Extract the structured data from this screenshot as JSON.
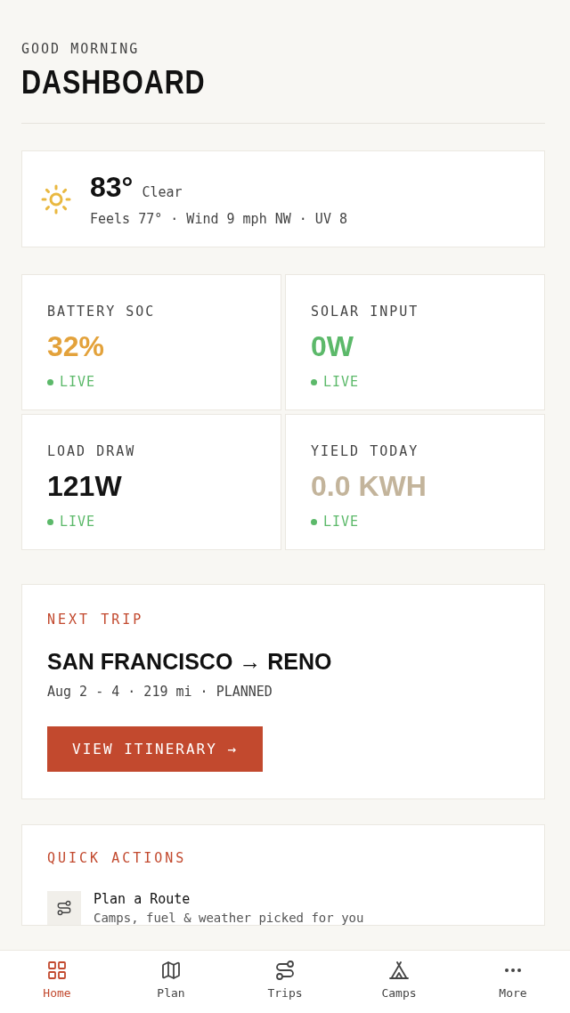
{
  "header": {
    "greeting": "GOOD MORNING",
    "title": "DASHBOARD"
  },
  "weather": {
    "temperature": "83°",
    "condition": "Clear",
    "details": "Feels 77° · Wind 9 mph NW · UV 8"
  },
  "metrics": [
    {
      "label": "BATTERY SOC",
      "value": "32%",
      "color": "#e3a23b",
      "status": "LIVE"
    },
    {
      "label": "SOLAR INPUT",
      "value": "0W",
      "color": "#5cb96a",
      "status": "LIVE"
    },
    {
      "label": "LOAD DRAW",
      "value": "121W",
      "color": "#141414",
      "status": "LIVE"
    },
    {
      "label": "YIELD TODAY",
      "value": "0.0 KWH",
      "color": "#c3b49b",
      "status": "LIVE"
    }
  ],
  "next_trip": {
    "heading": "NEXT TRIP",
    "route": "SAN FRANCISCO → RENO",
    "details": "Aug 2 - 4 · 219 mi · PLANNED",
    "button": "VIEW ITINERARY →"
  },
  "quick_actions": {
    "heading": "QUICK ACTIONS",
    "items": [
      {
        "kind": "route",
        "title": "Plan a Route",
        "subtitle": "Camps, fuel & weather picked for you"
      }
    ]
  },
  "nav": [
    {
      "kind": "home",
      "label": "Home",
      "selected": true
    },
    {
      "kind": "plan",
      "label": "Plan",
      "selected": false
    },
    {
      "kind": "trips",
      "label": "Trips",
      "selected": false
    },
    {
      "kind": "camps",
      "label": "Camps",
      "selected": false
    },
    {
      "kind": "more",
      "label": "More",
      "selected": false
    }
  ]
}
